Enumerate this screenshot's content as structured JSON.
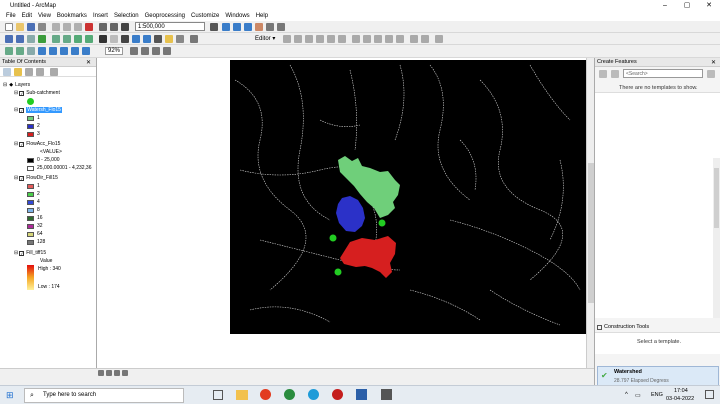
{
  "window": {
    "title": "Untitled - ArcMap"
  },
  "menu": [
    "File",
    "Edit",
    "View",
    "Bookmarks",
    "Insert",
    "Selection",
    "Geoprocessing",
    "Customize",
    "Windows",
    "Help"
  ],
  "toolbar": {
    "scale": "1:500,000",
    "zoom": "92%",
    "editor_label": "Editor ▾"
  },
  "toc": {
    "title": "Table Of Contents",
    "root": "Layers",
    "layers": [
      {
        "name": "Sub-catchment"
      },
      {
        "name": "Watersh_Flo15",
        "items": [
          {
            "label": "1",
            "color": "#6fcf7a"
          },
          {
            "label": "2",
            "color": "#2b31c8"
          },
          {
            "label": "3",
            "color": "#d61f1f"
          }
        ]
      },
      {
        "name": "FlowAcc_Flo15",
        "value_header": "<VALUE>",
        "ranges": [
          "0 - 25,000",
          "25,000.00001 - 4,232,36"
        ]
      },
      {
        "name": "FlowDir_Fill15",
        "items": [
          {
            "label": "1",
            "color": "#e35a5a"
          },
          {
            "label": "2",
            "color": "#4ccf4c"
          },
          {
            "label": "4",
            "color": "#3348d6"
          },
          {
            "label": "8",
            "color": "#7db4e8"
          },
          {
            "label": "16",
            "color": "#2f6b2f"
          },
          {
            "label": "32",
            "color": "#b02a9a"
          },
          {
            "label": "64",
            "color": "#d6d67a"
          },
          {
            "label": "128",
            "color": "#777777"
          }
        ]
      },
      {
        "name": "Fill_tiff15",
        "value_label": "Value",
        "high": "High : 340",
        "low": "Low : 174"
      }
    ]
  },
  "create_features": {
    "title": "Create Features",
    "search_placeholder": "<Search>",
    "empty_msg": "There are no templates to show.",
    "construction_title": "Construction Tools",
    "select_template": "Select a template."
  },
  "notification": {
    "title": "Watershed",
    "subtitle": "28.797 Elapsed Degress"
  },
  "taskbar": {
    "search_text": "Type here to search",
    "lang": "ENG",
    "time": "17:04",
    "date": "03-04-2022"
  },
  "colors": {
    "watershed1": "#6fcf7a",
    "watershed2": "#2b31c8",
    "watershed3": "#d61f1f",
    "outlet": "#22cc22"
  }
}
